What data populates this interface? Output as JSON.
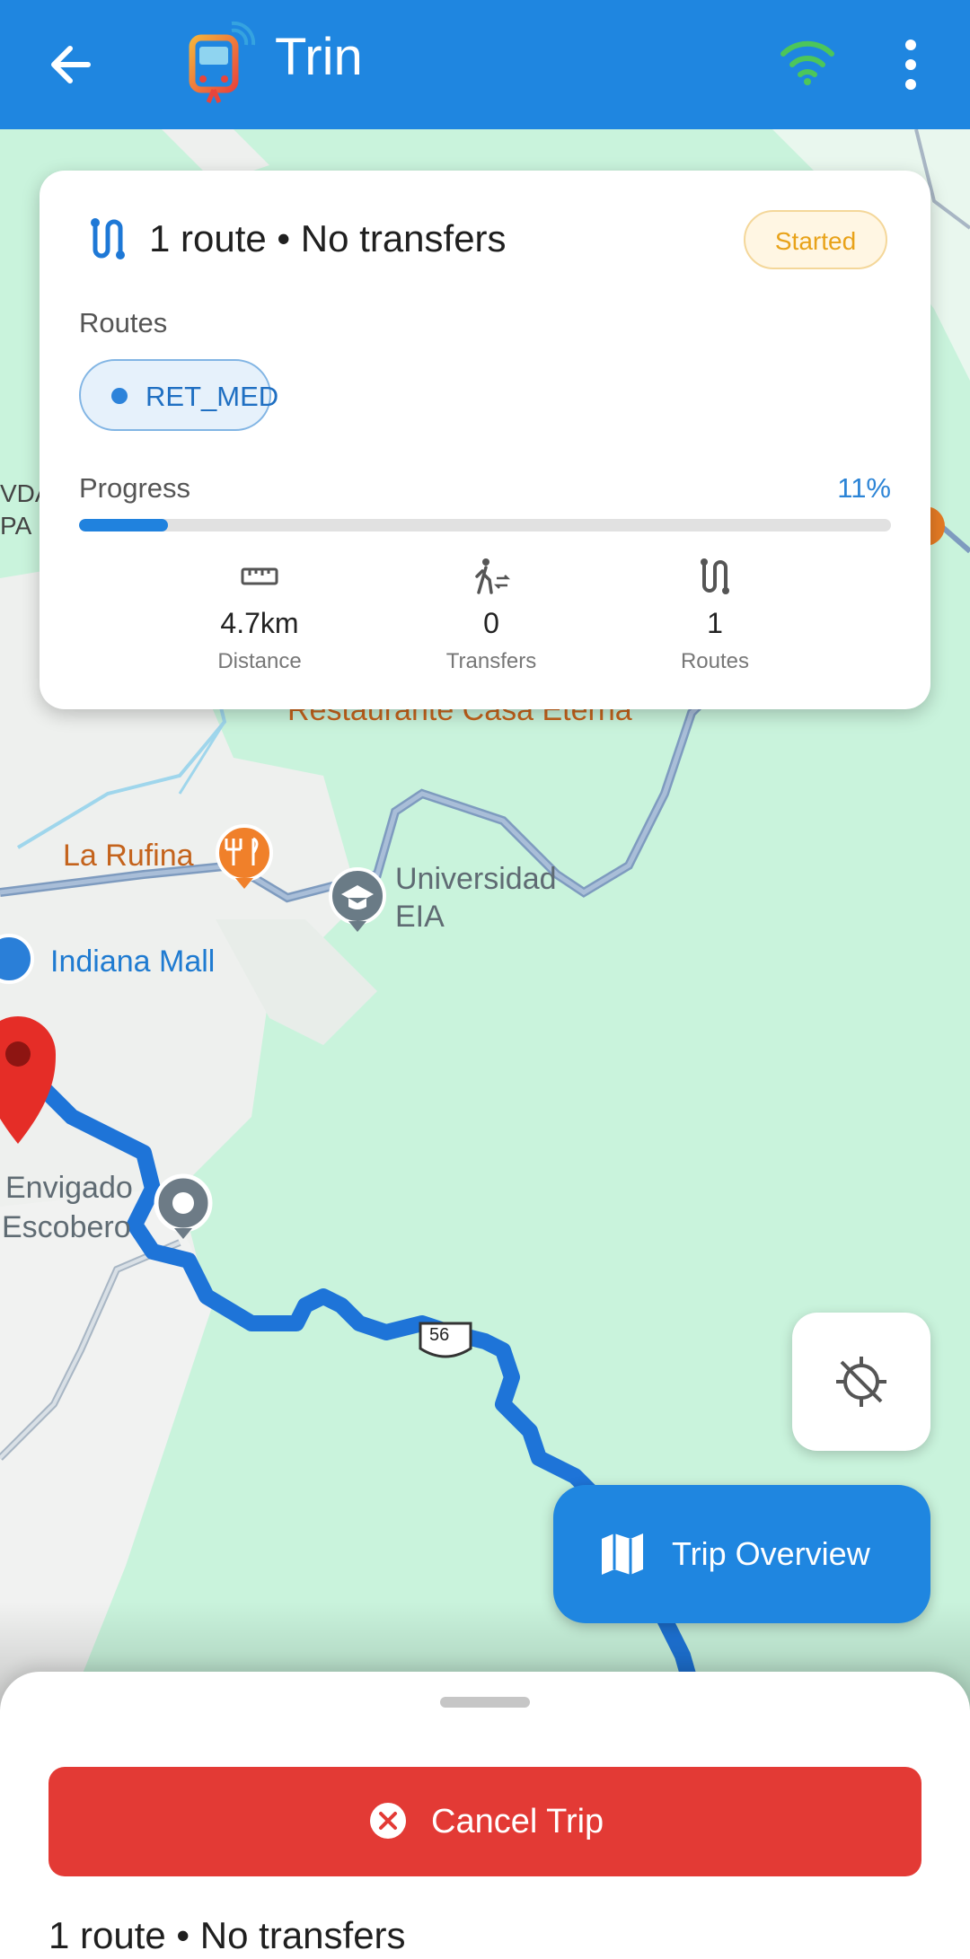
{
  "app_bar": {
    "title": "Trin",
    "back_icon": "arrow-left-icon",
    "status_icon": "wifi-icon",
    "menu_icon": "more-vert-icon",
    "accent_color": "#1f86e0"
  },
  "route_card": {
    "summary": "1 route • No transfers",
    "status": "Started",
    "routes_label": "Routes",
    "route_chips": [
      "RET_MED"
    ],
    "progress_label": "Progress",
    "progress_text": "11%",
    "progress_value": 0.11,
    "stats": [
      {
        "icon": "ruler-icon",
        "value": "4.7km",
        "label": "Distance"
      },
      {
        "icon": "transfer-walk-icon",
        "value": "0",
        "label": "Transfers"
      },
      {
        "icon": "route-icon",
        "value": "1",
        "label": "Routes"
      }
    ]
  },
  "map": {
    "labels": {
      "vda": "VDA",
      "pa": "PA",
      "restaurant": "Restaurante Casa Eterna",
      "la_rufina": "La Rufina",
      "universidad_1": "Universidad",
      "universidad_2": "EIA",
      "indiana_mall": "Indiana Mall",
      "envigado_1": "Envigado",
      "envigado_2": "Escobero",
      "highway_shield": "56"
    }
  },
  "buttons": {
    "gps_icon": "location-disabled-icon",
    "trip_overview": "Trip Overview",
    "trip_overview_icon": "map-icon",
    "cancel_trip": "Cancel Trip",
    "cancel_icon": "close-circle-icon"
  },
  "sheet": {
    "summary": "1 route • No transfers"
  },
  "colors": {
    "route_line": "#1e74d8",
    "cancel": "#e33a35",
    "status_badge": "#e8a219"
  }
}
